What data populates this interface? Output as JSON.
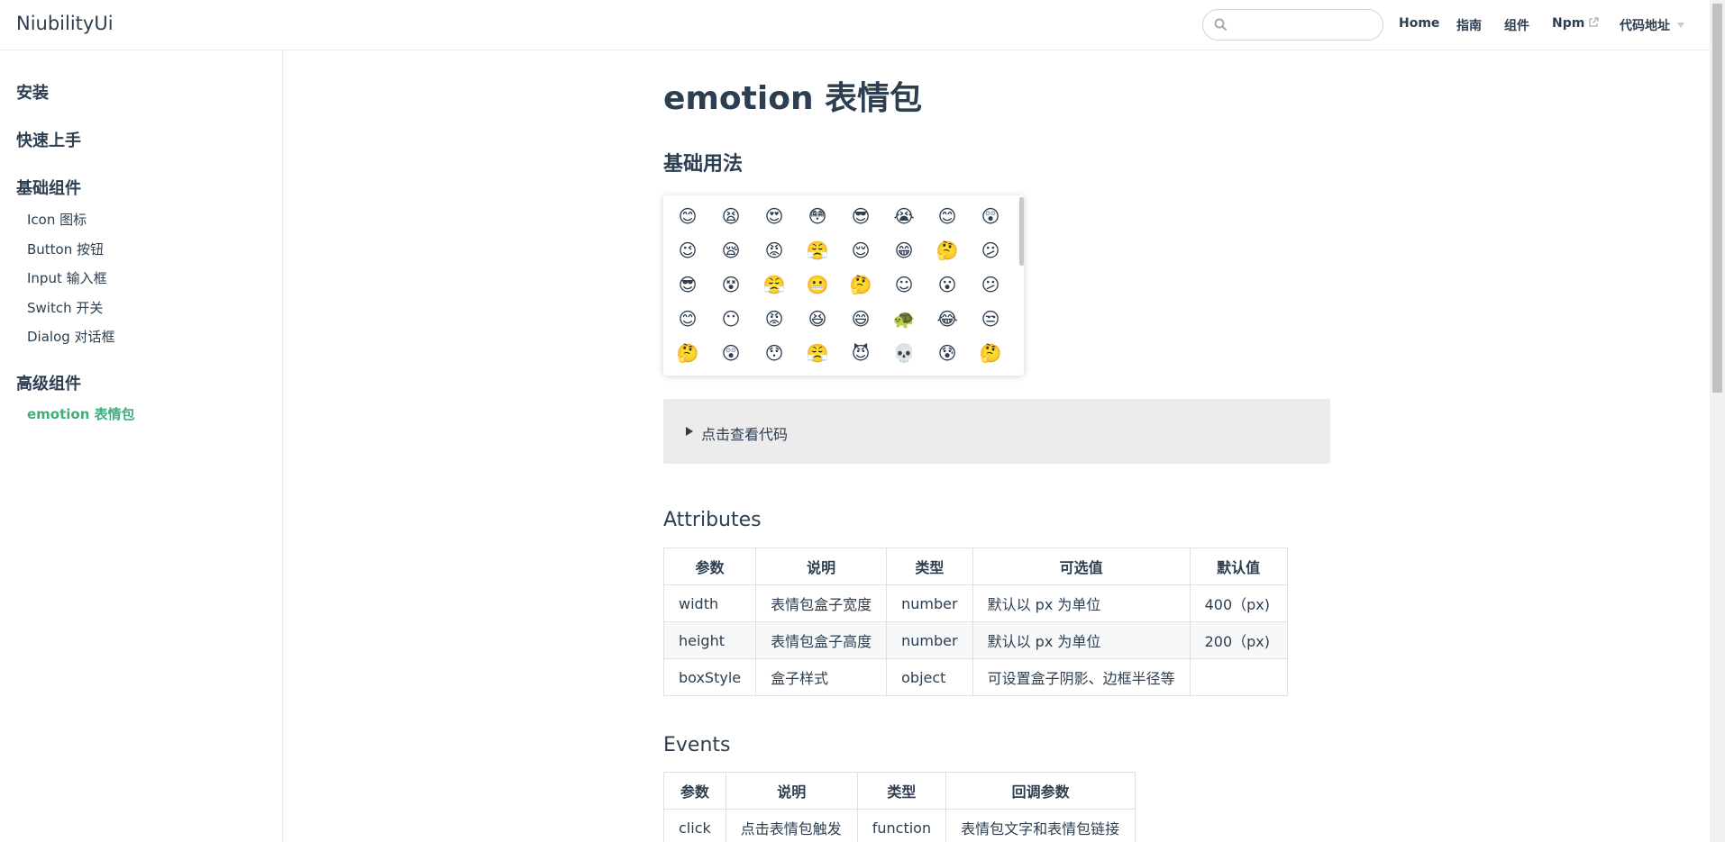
{
  "navbar": {
    "site_name": "NiubilityUi",
    "search": {
      "placeholder": "",
      "value": ""
    },
    "links": [
      {
        "label": "Home"
      },
      {
        "label": "指南"
      },
      {
        "label": "组件"
      },
      {
        "label": "Npm",
        "external": true
      },
      {
        "label": "代码地址",
        "dropdown": true
      }
    ]
  },
  "sidebar": {
    "groups": [
      {
        "label": "安装"
      },
      {
        "label": "快速上手"
      },
      {
        "label": "基础组件",
        "items": [
          "Icon 图标",
          "Button 按钮",
          "Input 输入框",
          "Switch 开关",
          "Dialog 对话框"
        ]
      },
      {
        "label": "高级组件",
        "items": [
          "emotion 表情包"
        ],
        "active_item": "emotion 表情包"
      }
    ],
    "active_color": "#3eaf7c"
  },
  "main": {
    "title": "emotion 表情包",
    "section_basic": "基础用法",
    "emoji_box": {
      "emojis": [
        "😊",
        "😫",
        "😍",
        "😳",
        "😎",
        "😭",
        "😊",
        "😲",
        "😉",
        "😪",
        "😡",
        "😤",
        "😌",
        "😁",
        "🤔",
        "😕",
        "😎",
        "😵",
        "😤",
        "😬",
        "🤔",
        "☺",
        "😮",
        "😕",
        "😊",
        "😶",
        "😡",
        "😆",
        "😄",
        "🐢",
        "😂",
        "😒",
        "🤔",
        "😲",
        "😯",
        "😤",
        "😈",
        "💀",
        "😰",
        "🤔"
      ]
    },
    "code_toggle_label": "点击查看代码",
    "attributes": {
      "heading": "Attributes",
      "columns": [
        "参数",
        "说明",
        "类型",
        "可选值",
        "默认值"
      ],
      "rows": [
        [
          "width",
          "表情包盒子宽度",
          "number",
          "默认以 px 为单位",
          "400（px)"
        ],
        [
          "height",
          "表情包盒子高度",
          "number",
          "默认以 px 为单位",
          "200（px)"
        ],
        [
          "boxStyle",
          "盒子样式",
          "object",
          "可设置盒子阴影、边框半径等",
          ""
        ]
      ]
    },
    "events": {
      "heading": "Events",
      "columns": [
        "参数",
        "说明",
        "类型",
        "回调参数"
      ],
      "rows": [
        [
          "click",
          "点击表情包触发",
          "function",
          "表情包文字和表情包链接"
        ]
      ]
    }
  }
}
